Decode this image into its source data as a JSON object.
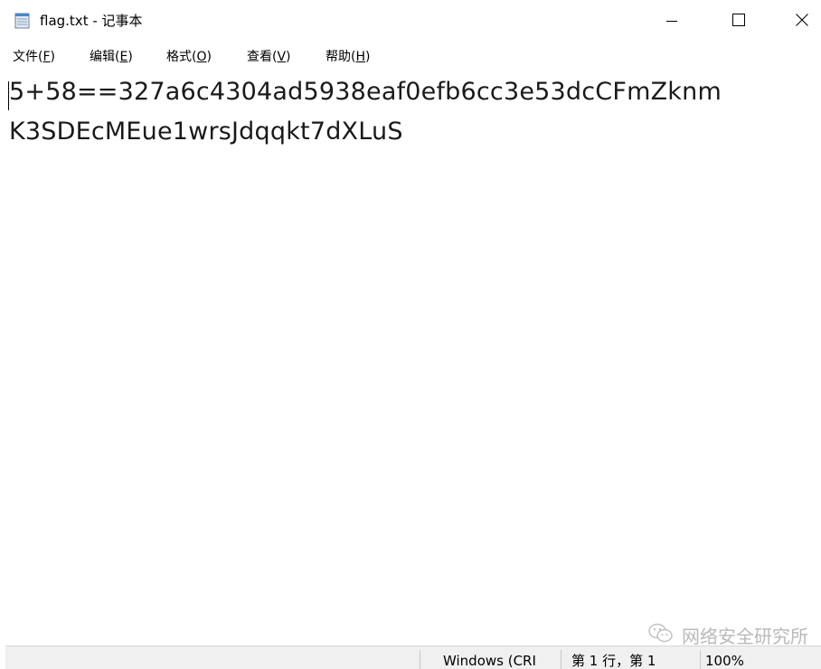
{
  "window": {
    "title": "flag.txt - 记事本"
  },
  "menu": {
    "items": [
      {
        "label": "文件(",
        "accel": "F",
        "close": ")"
      },
      {
        "label": "编辑(",
        "accel": "E",
        "close": ")"
      },
      {
        "label": "格式(",
        "accel": "O",
        "close": ")"
      },
      {
        "label": "查看(",
        "accel": "V",
        "close": ")"
      },
      {
        "label": "帮助(",
        "accel": "H",
        "close": ")"
      }
    ]
  },
  "editor": {
    "lines": [
      "5+58==327a6c4304ad5938eaf0efb6cc3e53dcCFmZknm",
      "K3SDEcMEue1wrsJdqqkt7dXLuS"
    ]
  },
  "watermark": {
    "text": "网络安全研究所"
  },
  "status": {
    "encoding": "Windows (CRI",
    "position": "第 1 行，第 1",
    "zoom": "100%"
  },
  "icons": {
    "app": "notepad-icon",
    "minimize": "minimize-icon",
    "maximize": "maximize-icon",
    "close": "close-icon",
    "watermark": "wechat-icon"
  }
}
